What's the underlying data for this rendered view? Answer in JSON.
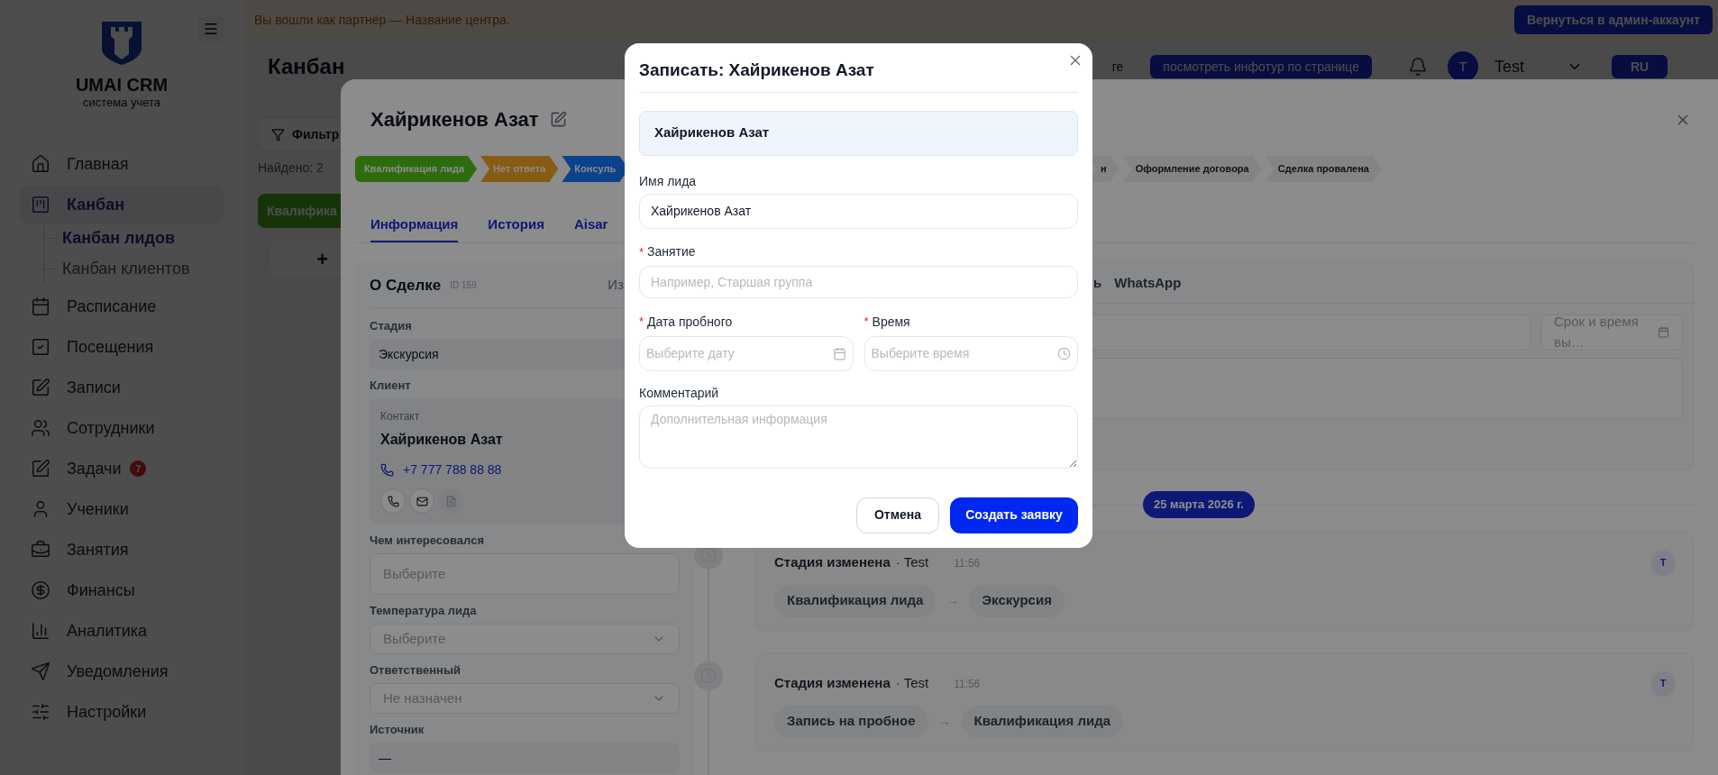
{
  "banner": {
    "text": "Вы вошли как партнёр — Название центра.",
    "button": "Вернуться в админ-аккаунт"
  },
  "sidebar": {
    "logo_title": "UMAI CRM",
    "logo_subtitle": "система учета",
    "items": [
      {
        "label": "Главная",
        "selected": false
      },
      {
        "label": "Канбан",
        "selected": true,
        "children": [
          {
            "label": "Канбан лидов",
            "selected": true
          },
          {
            "label": "Канбан клиентов",
            "selected": false
          }
        ]
      },
      {
        "label": "Расписание",
        "selected": false
      },
      {
        "label": "Посещения",
        "selected": false
      },
      {
        "label": "Записи",
        "selected": false
      },
      {
        "label": "Сотрудники",
        "selected": false
      },
      {
        "label": "Задачи",
        "selected": false,
        "badge": "7"
      },
      {
        "label": "Ученики",
        "selected": false
      },
      {
        "label": "Занятия",
        "selected": false
      },
      {
        "label": "Финансы",
        "selected": false
      },
      {
        "label": "Аналитика",
        "selected": false
      },
      {
        "label": "Уведомления",
        "selected": false
      },
      {
        "label": "Настройки",
        "selected": false
      }
    ]
  },
  "header": {
    "title": "Канбан",
    "link_fragment": "ге",
    "tour_button": "посмотреть инфотур по странице",
    "avatar": "T",
    "user": "Test",
    "language": "RU"
  },
  "board": {
    "filter_button": "Фильтр",
    "found": "Найдено: 2",
    "column_title": "Квалифика",
    "add": "+"
  },
  "drawer": {
    "title": "Хайрикенов Азат",
    "stages": [
      {
        "label": "Квалификация лида",
        "color": "#2d6c0e"
      },
      {
        "label": "Нет ответа",
        "color": "#875b13"
      },
      {
        "label": "Консуль",
        "color": "#0c418c"
      },
      {
        "label": "н",
        "color": "#838486"
      },
      {
        "label": "Оформление договора",
        "color": "#838486"
      },
      {
        "label": "Сделка провалена",
        "color": "#838486"
      }
    ],
    "tabs": [
      {
        "label": "Информация",
        "selected": true
      },
      {
        "label": "История",
        "selected": false
      },
      {
        "label": "Aisar",
        "selected": false
      }
    ],
    "deal": {
      "title": "О Сделке",
      "id": "ID 159",
      "action_fragment": "Из",
      "fields": [
        {
          "kind": "value",
          "label": "Стадия",
          "value": "Экскурсия"
        },
        {
          "kind": "contact",
          "label": "Клиент",
          "caption": "Контакт",
          "name": "Хайрикенов Азат",
          "phone": "+7 777 788 88 88",
          "actions": [
            {
              "disabled": false
            },
            {
              "disabled": false
            },
            {
              "disabled": true
            }
          ]
        },
        {
          "kind": "input",
          "label": "Чем интересовался",
          "placeholder": "Выберите"
        },
        {
          "kind": "select",
          "label": "Температура лида",
          "placeholder": "Выберите"
        },
        {
          "kind": "select",
          "label": "Ответственный",
          "placeholder": "Не назначен"
        },
        {
          "kind": "value",
          "label": "Источник",
          "value": "—"
        }
      ]
    },
    "activity": {
      "tabs": [
        {
          "label": "ь"
        },
        {
          "label": "WhatsApp"
        }
      ],
      "deadline_placeholder": "Срок и время вы…"
    },
    "timeline": {
      "date": "25 марта 2026 г.",
      "events": [
        {
          "title": "Стадия изменена",
          "author": "· Test",
          "time": "11:56",
          "avatar": "T",
          "from": "Квалификация лида",
          "arrow": "→",
          "to": "Экскурсия"
        },
        {
          "title": "Стадия изменена",
          "author": "· Test",
          "time": "11:56",
          "avatar": "T",
          "from": "Запись на пробное",
          "arrow": "→",
          "to": "Квалификация лида"
        }
      ]
    }
  },
  "modal": {
    "title": "Записать: Хайрикенов Азат",
    "lead": "Хайрикенов Азат",
    "required_mark": "*",
    "fields": [
      {
        "kind": "text",
        "label": "Имя лида",
        "required": false,
        "value": "Хайрикенов Азат"
      },
      {
        "kind": "text",
        "label": "Занятие",
        "required": true,
        "placeholder": "Например, Старшая группа"
      },
      {
        "kind": "pair",
        "items": [
          {
            "kind": "date",
            "label": "Дата пробного",
            "required": true,
            "placeholder": "Выберите дату"
          },
          {
            "kind": "time",
            "label": "Время",
            "required": true,
            "placeholder": "Выберите время"
          }
        ]
      },
      {
        "kind": "textarea",
        "label": "Комментарий",
        "required": false,
        "placeholder": "Дополнительная информация"
      }
    ],
    "cancel": "Отмена",
    "submit": "Создать заявку"
  }
}
